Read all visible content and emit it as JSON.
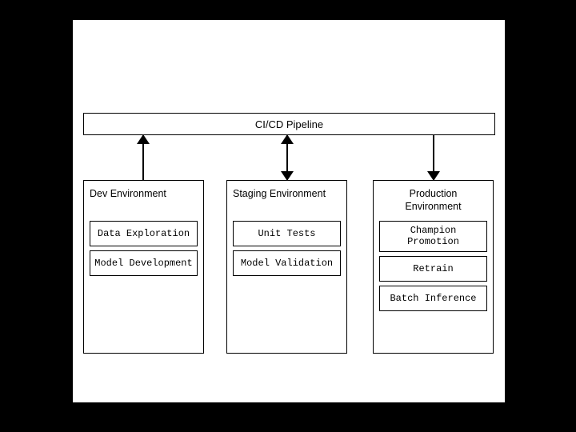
{
  "pipeline": {
    "label": "CI/CD Pipeline"
  },
  "arrows": {
    "dev_to_pipeline": "up",
    "staging_pipeline": "both",
    "pipeline_to_production": "down"
  },
  "environments": [
    {
      "key": "dev",
      "title": "Dev Environment",
      "tasks": [
        "Data Exploration",
        "Model Development"
      ]
    },
    {
      "key": "staging",
      "title": "Staging Environment",
      "tasks": [
        "Unit Tests",
        "Model Validation"
      ]
    },
    {
      "key": "production",
      "title": "Production Environment",
      "tasks": [
        "Champion Promotion",
        "Retrain",
        "Batch Inference"
      ]
    }
  ]
}
